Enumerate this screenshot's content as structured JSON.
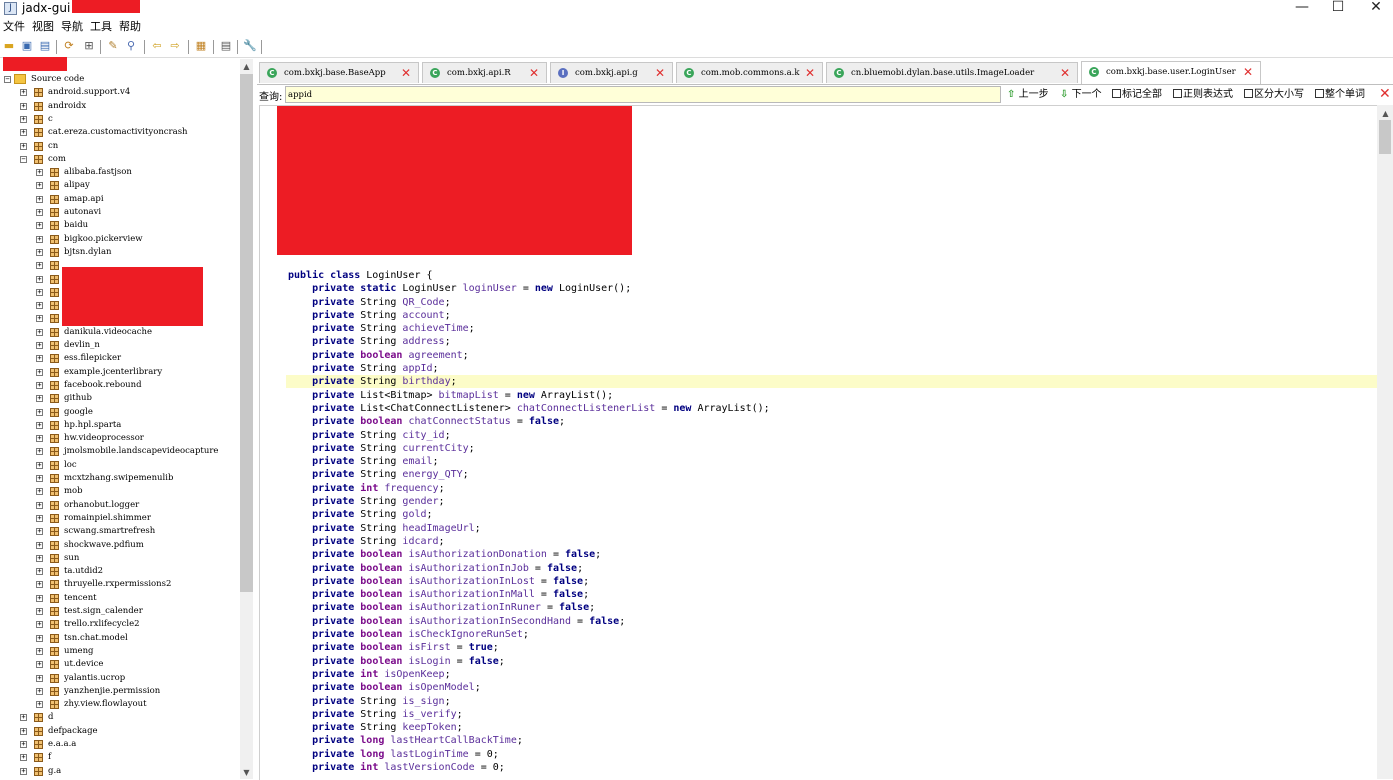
{
  "window": {
    "title": "jadx-gui -",
    "controls": {
      "minimize": "—",
      "maximize": "☐",
      "close": "✕"
    }
  },
  "menu": [
    "文件",
    "视图",
    "导航",
    "工具",
    "帮助"
  ],
  "toolbar_icons": [
    "open-file-icon",
    "save-icon",
    "save-all-icon",
    "sync-icon",
    "flat-packages-icon",
    "find-icon",
    "search-icon",
    "back-icon",
    "forward-icon",
    "deobfuscation-icon",
    "log-icon",
    "preferences-icon"
  ],
  "tree": {
    "root": "Source code",
    "items": [
      {
        "label": "android.support.v4",
        "level": 1,
        "expanded": false
      },
      {
        "label": "androidx",
        "level": 1,
        "expanded": false
      },
      {
        "label": "c",
        "level": 1,
        "expanded": false
      },
      {
        "label": "cat.ereza.customactivityoncrash",
        "level": 1,
        "expanded": false
      },
      {
        "label": "cn",
        "level": 1,
        "expanded": false
      },
      {
        "label": "com",
        "level": 1,
        "expanded": true
      },
      {
        "label": "alibaba.fastjson",
        "level": 2,
        "expanded": false
      },
      {
        "label": "alipay",
        "level": 2,
        "expanded": false
      },
      {
        "label": "amap.api",
        "level": 2,
        "expanded": false
      },
      {
        "label": "autonavi",
        "level": 2,
        "expanded": false
      },
      {
        "label": "baidu",
        "level": 2,
        "expanded": false
      },
      {
        "label": "bigkoo.pickerview",
        "level": 2,
        "expanded": false
      },
      {
        "label": "bjtsn.dylan",
        "level": 2,
        "expanded": false
      },
      {
        "label": "",
        "level": 2,
        "expanded": false
      },
      {
        "label": "",
        "level": 2,
        "expanded": false
      },
      {
        "label": "",
        "level": 2,
        "expanded": false
      },
      {
        "label": "",
        "level": 2,
        "expanded": false
      },
      {
        "label": "",
        "level": 2,
        "expanded": false
      },
      {
        "label": "danikula.videocache",
        "level": 2,
        "expanded": false
      },
      {
        "label": "devlin_n",
        "level": 2,
        "expanded": false
      },
      {
        "label": "ess.filepicker",
        "level": 2,
        "expanded": false
      },
      {
        "label": "example.jcenterlibrary",
        "level": 2,
        "expanded": false
      },
      {
        "label": "facebook.rebound",
        "level": 2,
        "expanded": false
      },
      {
        "label": "github",
        "level": 2,
        "expanded": false
      },
      {
        "label": "google",
        "level": 2,
        "expanded": false
      },
      {
        "label": "hp.hpl.sparta",
        "level": 2,
        "expanded": false
      },
      {
        "label": "hw.videoprocessor",
        "level": 2,
        "expanded": false
      },
      {
        "label": "jmolsmobile.landscapevideocapture",
        "level": 2,
        "expanded": false
      },
      {
        "label": "loc",
        "level": 2,
        "expanded": false
      },
      {
        "label": "mcxtzhang.swipemenulib",
        "level": 2,
        "expanded": false
      },
      {
        "label": "mob",
        "level": 2,
        "expanded": false
      },
      {
        "label": "orhanobut.logger",
        "level": 2,
        "expanded": false
      },
      {
        "label": "romainpiel.shimmer",
        "level": 2,
        "expanded": false
      },
      {
        "label": "scwang.smartrefresh",
        "level": 2,
        "expanded": false
      },
      {
        "label": "shockwave.pdfium",
        "level": 2,
        "expanded": false
      },
      {
        "label": "sun",
        "level": 2,
        "expanded": false
      },
      {
        "label": "ta.utdid2",
        "level": 2,
        "expanded": false
      },
      {
        "label": "thruyelle.rxpermissions2",
        "level": 2,
        "expanded": false
      },
      {
        "label": "tencent",
        "level": 2,
        "expanded": false
      },
      {
        "label": "test.sign_calender",
        "level": 2,
        "expanded": false
      },
      {
        "label": "trello.rxlifecycle2",
        "level": 2,
        "expanded": false
      },
      {
        "label": "tsn.chat.model",
        "level": 2,
        "expanded": false
      },
      {
        "label": "umeng",
        "level": 2,
        "expanded": false
      },
      {
        "label": "ut.device",
        "level": 2,
        "expanded": false
      },
      {
        "label": "yalantis.ucrop",
        "level": 2,
        "expanded": false
      },
      {
        "label": "yanzhenjie.permission",
        "level": 2,
        "expanded": false
      },
      {
        "label": "zhy.view.flowlayout",
        "level": 2,
        "expanded": false
      },
      {
        "label": "d",
        "level": 1,
        "expanded": false
      },
      {
        "label": "defpackage",
        "level": 1,
        "expanded": false
      },
      {
        "label": "e.a.a.a",
        "level": 1,
        "expanded": false
      },
      {
        "label": "f",
        "level": 1,
        "expanded": false
      },
      {
        "label": "g.a",
        "level": 1,
        "expanded": false
      }
    ]
  },
  "tabs": [
    {
      "label": "com.bxkj.base.BaseApp",
      "kind": "class",
      "active": false
    },
    {
      "label": "com.bxkj.api.R",
      "kind": "class",
      "active": false
    },
    {
      "label": "com.bxkj.api.g",
      "kind": "interface",
      "active": false
    },
    {
      "label": "com.mob.commons.a.k",
      "kind": "class",
      "active": false
    },
    {
      "label": "cn.bluemobi.dylan.base.utils.ImageLoader",
      "kind": "class",
      "active": false
    },
    {
      "label": "com.bxkj.base.user.LoginUser",
      "kind": "class",
      "active": true
    }
  ],
  "search": {
    "label": "查询:",
    "value": "appid",
    "prev": "上一步",
    "next": "下一个",
    "mark_all": "标记全部",
    "regex": "正则表达式",
    "case": "区分大小写",
    "whole_word": "整个单词"
  },
  "code": {
    "highlight_line_index": 8,
    "lines": [
      "public class LoginUser {",
      "    private static LoginUser loginUser = new LoginUser();",
      "    private String QR_Code;",
      "    private String account;",
      "    private String achieveTime;",
      "    private String address;",
      "    private boolean agreement;",
      "    private String appId;",
      "    private String birthday;",
      "    private List<Bitmap> bitmapList = new ArrayList();",
      "    private List<ChatConnectListener> chatConnectListenerList = new ArrayList();",
      "    private boolean chatConnectStatus = false;",
      "    private String city_id;",
      "    private String currentCity;",
      "    private String email;",
      "    private String energy_QTY;",
      "    private int frequency;",
      "    private String gender;",
      "    private String gold;",
      "    private String headImageUrl;",
      "    private String idcard;",
      "    private boolean isAuthorizationDonation = false;",
      "    private boolean isAuthorizationInJob = false;",
      "    private boolean isAuthorizationInLost = false;",
      "    private boolean isAuthorizationInMall = false;",
      "    private boolean isAuthorizationInRuner = false;",
      "    private boolean isAuthorizationInSecondHand = false;",
      "    private boolean isCheckIgnoreRunSet;",
      "    private boolean isFirst = true;",
      "    private boolean isLogin = false;",
      "    private int isOpenKeep;",
      "    private boolean isOpenModel;",
      "    private String is_sign;",
      "    private String is_verify;",
      "    private String keepToken;",
      "    private long lastHeartCallBackTime;",
      "    private long lastLoginTime = 0;",
      "    private int lastVersionCode = 0;"
    ]
  }
}
